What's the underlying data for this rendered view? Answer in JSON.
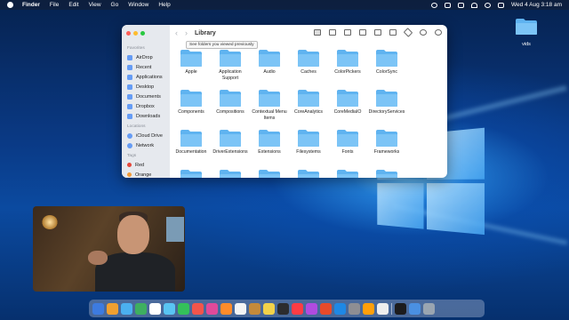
{
  "menubar": {
    "app_name": "Finder",
    "menus": [
      "File",
      "Edit",
      "View",
      "Go",
      "Window",
      "Help"
    ],
    "clock": "Wed 4 Aug  3:18 am"
  },
  "desktop": {
    "folder_label": "vids"
  },
  "finder": {
    "title": "Library",
    "tooltip": "See folders you viewed previously",
    "sidebar": {
      "favorites_header": "Favorites",
      "favorites": [
        "AirDrop",
        "Recent",
        "Applications",
        "Desktop",
        "Documents",
        "Dropbox",
        "Downloads"
      ],
      "locations_header": "Locations",
      "locations": [
        "iCloud Drive",
        "Network"
      ],
      "tags_header": "Tags",
      "tags": [
        {
          "label": "Red",
          "color": "#e5473a"
        },
        {
          "label": "Orange",
          "color": "#f29b38"
        }
      ]
    },
    "folders": [
      [
        "Apple",
        "Application Support",
        "Audio",
        "Caches",
        "ColorPickers",
        "ColorSync"
      ],
      [
        "Components",
        "Compositions",
        "Contextual Menu Items",
        "CoreAnalytics",
        "CoreMediaIO",
        "DirectoryServices"
      ],
      [
        "Documentation",
        "DriverExtensions",
        "Extensions",
        "Filesystems",
        "Fonts",
        "Frameworks"
      ],
      [
        "",
        "",
        "",
        "",
        "",
        ""
      ]
    ],
    "folder_color": "#5fb3f0"
  },
  "dock": {
    "icon_colors": [
      "#3d7be0",
      "#f0a030",
      "#4bb0f0",
      "#3eaf60",
      "#ffffff",
      "#59c4f2",
      "#34c05a",
      "#f2554b",
      "#e04a9a",
      "#ff8c2a",
      "#f4f4f4",
      "#c48a3a",
      "#f2d24a",
      "#2c2c2e",
      "#fc3c44",
      "#b04be0",
      "#e84a2a",
      "#1e88e5",
      "#8e8e93",
      "#ff9f0a",
      "#eeeeee",
      "#1c1c1e",
      "#4a90e2",
      "#9aa5b1"
    ]
  }
}
